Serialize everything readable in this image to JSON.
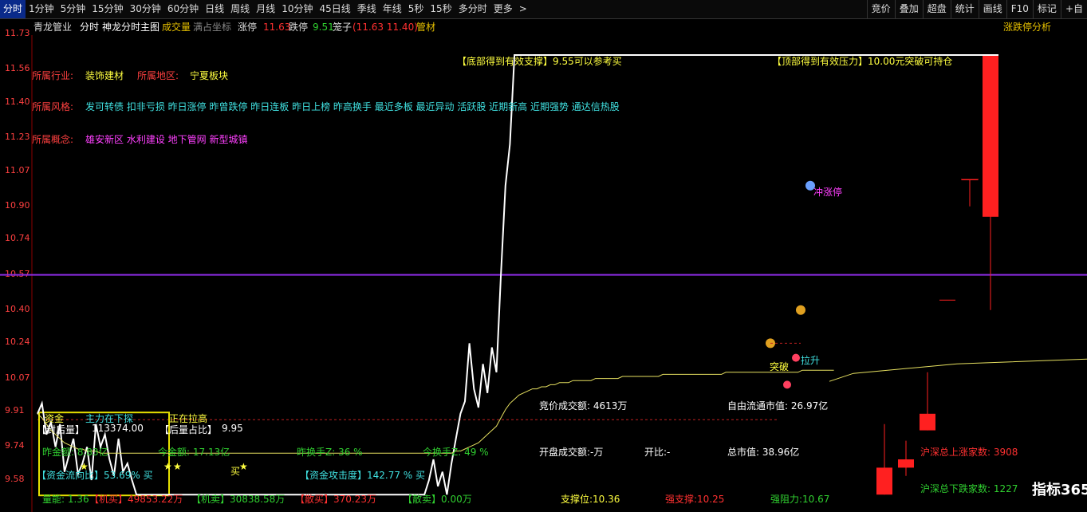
{
  "toolbar": {
    "tabs": [
      "分时",
      "1分钟",
      "5分钟",
      "15分钟",
      "30分钟",
      "60分钟",
      "日线",
      "周线",
      "月线",
      "10分钟",
      "45日线",
      "季线",
      "年线",
      "5秒",
      "15秒",
      "多分时",
      "更多"
    ],
    "more_arrow": ">",
    "right_tabs": [
      "竞价",
      "叠加",
      "超盘",
      "统计",
      "画线",
      "F10",
      "标记"
    ],
    "right_extra": "+自"
  },
  "info_bar": {
    "stock_name": "青龙管业",
    "view_name": "分时",
    "indicator_name": "神龙分时主图",
    "volume_label": "成交量",
    "coord_label": "满占坐标",
    "limit_up_label": "涨停",
    "limit_up_value": "11.63",
    "limit_down_label": "跌停",
    "limit_down_value": "9.51",
    "cage_label": "笼子",
    "cage_value": "(11.63 11.40)",
    "industry_tag": "管材",
    "right_link": "涨跌停分析"
  },
  "y_axis": {
    "labels": [
      "11.73",
      "11.56",
      "11.40",
      "11.23",
      "11.07",
      "10.90",
      "10.74",
      "10.57",
      "10.40",
      "10.24",
      "10.07",
      "9.91",
      "9.74",
      "9.58"
    ]
  },
  "profile": {
    "industry_label": "所属行业:",
    "industry_value": "装饰建材",
    "region_label": "所属地区:",
    "region_value": "宁夏板块",
    "style_label": "所属风格:",
    "style_value": "发可转债 扣非亏损 昨日涨停 昨曾跌停 昨日连板 昨日上榜 昨高换手 最近多板 最近异动 活跃股 近期新高 近期强势 通达信热股",
    "concept_label": "所属概念:",
    "concept_value": "雄安新区 水利建设 地下管网 新型城镇"
  },
  "annotations": {
    "bottom_support": "【底部得到有效支撑】9.55可以参考买",
    "top_pressure": "【顶部得到有效压力】10.00元突破可持仓",
    "chong_zhangting": "冲涨停",
    "la_sheng": "拉升",
    "tu_po": "突破",
    "buy": "买",
    "fund": "资金",
    "main_probe": "主力在下探",
    "pulling_up": "正在拉高",
    "seal_vol": "【封后量】",
    "seal_vol_value": "113374.00",
    "after_ratio": "【后量占比】",
    "after_ratio_value": "9.95",
    "yday_amount": "昨金额: 8.83亿",
    "today_amount": "今金额: 17.13亿",
    "yday_turnover": "昨换手Z: 36 %",
    "today_turnover": "今换手Z: 49 %",
    "fund_flow": "【资金流向比】53.69% 买",
    "fund_attack": "【资金攻击度】142.77 % 买",
    "auction_amount": "竞价成交额: 4613万",
    "open_amount": "开盘成交额:-万",
    "open_ratio": "开比:-",
    "free_mv": "自由流通市值: 26.97亿",
    "total_mv": "总市值: 38.96亿",
    "hs_up": "沪深总上涨家数: 3908",
    "hs_down": "沪深总下跌家数: 1227"
  },
  "bottom_bar": {
    "energy": "量能: 1.36",
    "inst_buy": "【机买】49853.22万",
    "inst_sell": "【机卖】30838.58万",
    "retail_buy": "【散买】370.23万",
    "retail_sell": "【散卖】0.00万",
    "support": "支撑位:10.36",
    "strong_support": "强支撑:10.25",
    "strong_resist": "强阻力:10.67"
  },
  "watermark": "指标365",
  "colors": {
    "price_line": "#ffffff",
    "avg_line": "#e6e060",
    "purple_line": "#8a2be2",
    "red": "#ff2020",
    "cyan": "#40e0e0"
  },
  "chart_data": {
    "type": "line",
    "y_axis_labels": [
      11.73,
      11.56,
      11.4,
      11.23,
      11.07,
      10.9,
      10.74,
      10.57,
      10.4,
      10.24,
      10.07,
      9.91,
      9.74,
      9.58
    ],
    "ylim": [
      9.51,
      11.73
    ],
    "limit_up": 11.63,
    "reference_line": 10.57,
    "series": [
      {
        "values": [
          9.9,
          9.95,
          9.8,
          9.86,
          9.74,
          9.85,
          9.62,
          9.7,
          9.78,
          9.61,
          9.66,
          9.74,
          9.58,
          9.85,
          9.74,
          9.8,
          9.68,
          9.6,
          9.78,
          9.62,
          9.66,
          9.58,
          9.51,
          9.51,
          9.51,
          9.51,
          9.51,
          9.51,
          9.51,
          9.51,
          9.51,
          9.51,
          9.51,
          9.51,
          9.51,
          9.51,
          9.51,
          9.51,
          9.51,
          9.51,
          9.51,
          9.51,
          9.51,
          9.51,
          9.51,
          9.51,
          9.51,
          9.51,
          9.51,
          9.51,
          9.51,
          9.51,
          9.51,
          9.51,
          9.51,
          9.51,
          9.51,
          9.51,
          9.51,
          9.51,
          9.51,
          9.51,
          9.51,
          9.51,
          9.51,
          9.51,
          9.51,
          9.51,
          9.51,
          9.51,
          9.51,
          9.51,
          9.51,
          9.51,
          9.51,
          9.51,
          9.51,
          9.51,
          9.51,
          9.51,
          9.51,
          9.51,
          9.51,
          9.51,
          9.51,
          9.51,
          9.51,
          9.58,
          9.68,
          9.55,
          9.62,
          9.51,
          9.66,
          9.78,
          9.9,
          9.96,
          10.24,
          10.02,
          9.93,
          10.14,
          10.0,
          10.22,
          10.1,
          10.57,
          11.0,
          11.2,
          11.63,
          11.63,
          11.63,
          11.63,
          11.63,
          11.63,
          11.63,
          11.63,
          11.63,
          11.63,
          11.63,
          11.63,
          11.63,
          11.63,
          11.63,
          11.63,
          11.63,
          11.63,
          11.63,
          11.63,
          11.63,
          11.63,
          11.63,
          11.63,
          11.63,
          11.63,
          11.63,
          11.63,
          11.63,
          11.63,
          11.63,
          11.63,
          11.63,
          11.63,
          11.63,
          11.63,
          11.63,
          11.63,
          11.63,
          11.63,
          11.63,
          11.63,
          11.63,
          11.63,
          11.63,
          11.63,
          11.63,
          11.63,
          11.63,
          11.63,
          11.63,
          11.63,
          11.63,
          11.63,
          11.63,
          11.63,
          11.63,
          11.63,
          11.63,
          11.63,
          11.63,
          11.63,
          11.63,
          11.63,
          11.63,
          11.63,
          11.63,
          11.63,
          11.63,
          11.63,
          11.63
        ]
      },
      {
        "values": [
          9.9,
          9.88,
          9.85,
          9.82,
          9.8,
          9.78,
          9.76,
          9.75,
          9.74,
          9.73,
          9.73,
          9.72,
          9.72,
          9.72,
          9.71,
          9.71,
          9.71,
          9.71,
          9.71,
          9.71,
          9.71,
          9.71,
          9.71,
          9.71,
          9.71,
          9.71,
          9.71,
          9.71,
          9.71,
          9.71,
          9.71,
          9.71,
          9.71,
          9.71,
          9.71,
          9.71,
          9.71,
          9.71,
          9.71,
          9.71,
          9.71,
          9.71,
          9.71,
          9.71,
          9.71,
          9.71,
          9.71,
          9.71,
          9.71,
          9.71,
          9.71,
          9.71,
          9.71,
          9.71,
          9.71,
          9.71,
          9.71,
          9.71,
          9.71,
          9.71,
          9.71,
          9.71,
          9.71,
          9.71,
          9.71,
          9.71,
          9.71,
          9.71,
          9.71,
          9.71,
          9.71,
          9.71,
          9.71,
          9.71,
          9.71,
          9.71,
          9.71,
          9.71,
          9.71,
          9.71,
          9.71,
          9.71,
          9.71,
          9.71,
          9.71,
          9.71,
          9.71,
          9.71,
          9.71,
          9.71,
          9.71,
          9.71,
          9.71,
          9.72,
          9.72,
          9.73,
          9.74,
          9.75,
          9.76,
          9.78,
          9.8,
          9.82,
          9.84,
          9.88,
          9.92,
          9.95,
          9.97,
          9.99,
          10.0,
          10.01,
          10.02,
          10.02,
          10.03,
          10.03,
          10.04,
          10.04,
          10.05,
          10.05,
          10.05,
          10.06,
          10.06,
          10.06,
          10.06,
          10.06,
          10.07,
          10.07,
          10.07,
          10.07,
          10.07,
          10.07,
          10.08,
          10.08,
          10.08,
          10.08,
          10.08,
          10.08,
          10.08,
          10.08,
          10.08,
          10.09,
          10.09,
          10.09,
          10.09,
          10.09,
          10.09,
          10.09,
          10.09,
          10.09,
          10.09,
          10.09,
          10.09,
          10.09,
          10.09,
          10.1,
          10.1,
          10.1,
          10.1,
          10.1,
          10.1,
          10.1,
          10.1,
          10.1,
          10.1,
          10.1,
          10.1,
          10.1,
          10.1,
          10.1,
          10.1,
          10.1,
          10.11,
          10.11,
          10.11,
          10.11,
          10.11,
          10.11,
          10.11,
          10.11
        ]
      }
    ]
  }
}
